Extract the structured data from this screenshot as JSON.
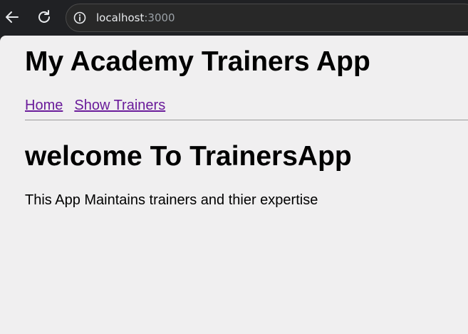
{
  "browser": {
    "url_host": "localhost",
    "url_port": ":3000",
    "icons": {
      "back": "arrow-left-icon",
      "reload": "reload-icon",
      "site_info": "info-icon"
    }
  },
  "page": {
    "app_title": "My Academy Trainers App",
    "nav": [
      {
        "label": "Home"
      },
      {
        "label": "Show Trainers"
      }
    ],
    "welcome_heading": "welcome To TrainersApp",
    "intro_text": "This App Maintains trainers and thier expertise"
  },
  "colors": {
    "chrome_bg": "#202124",
    "page_bg": "#f0eff0",
    "visited_link": "#6a1b9a"
  }
}
